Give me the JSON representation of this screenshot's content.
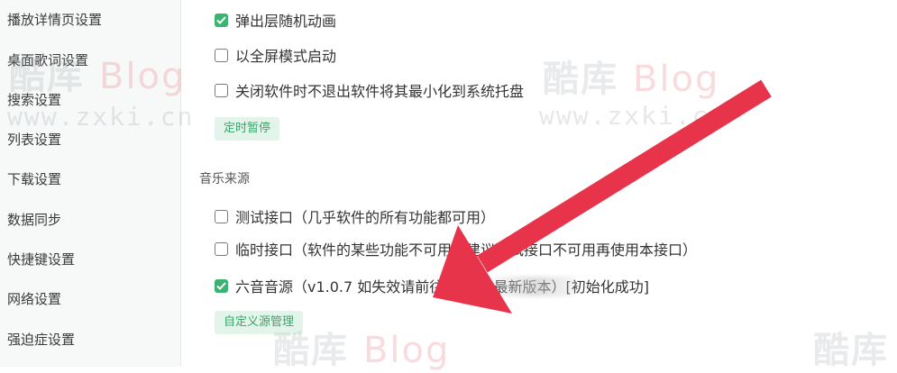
{
  "sidebar": {
    "items": [
      {
        "label": "播放详情页设置"
      },
      {
        "label": "桌面歌词设置"
      },
      {
        "label": "搜索设置"
      },
      {
        "label": "列表设置"
      },
      {
        "label": "下载设置"
      },
      {
        "label": "数据同步"
      },
      {
        "label": "快捷键设置"
      },
      {
        "label": "网络设置"
      },
      {
        "label": "强迫症设置"
      }
    ]
  },
  "general": {
    "options": [
      {
        "label": "弹出层随机动画",
        "checked": true
      },
      {
        "label": "以全屏模式启动",
        "checked": false
      },
      {
        "label": "关闭软件时不退出软件将其最小化到系统托盘",
        "checked": false
      }
    ],
    "timer_button": "定时暂停"
  },
  "music_source": {
    "title": "音乐来源",
    "options": [
      {
        "label": "测试接口（几乎软件的所有功能都可用）",
        "checked": false
      },
      {
        "label": "临时接口（软件的某些功能不可用，建议测试接口不可用再使用本接口）",
        "checked": false
      },
      {
        "label": "六音音源（v1.0.7 如失效请前往 w                下载最新版本）[初始化成功]",
        "checked": true
      }
    ],
    "custom_button": "自定义源管理"
  },
  "watermark": {
    "cn": "酷库",
    "blog": "Blog",
    "url": "www.zxki.cn"
  },
  "colors": {
    "accent": "#3cb371",
    "arrow": "#e8344a"
  }
}
